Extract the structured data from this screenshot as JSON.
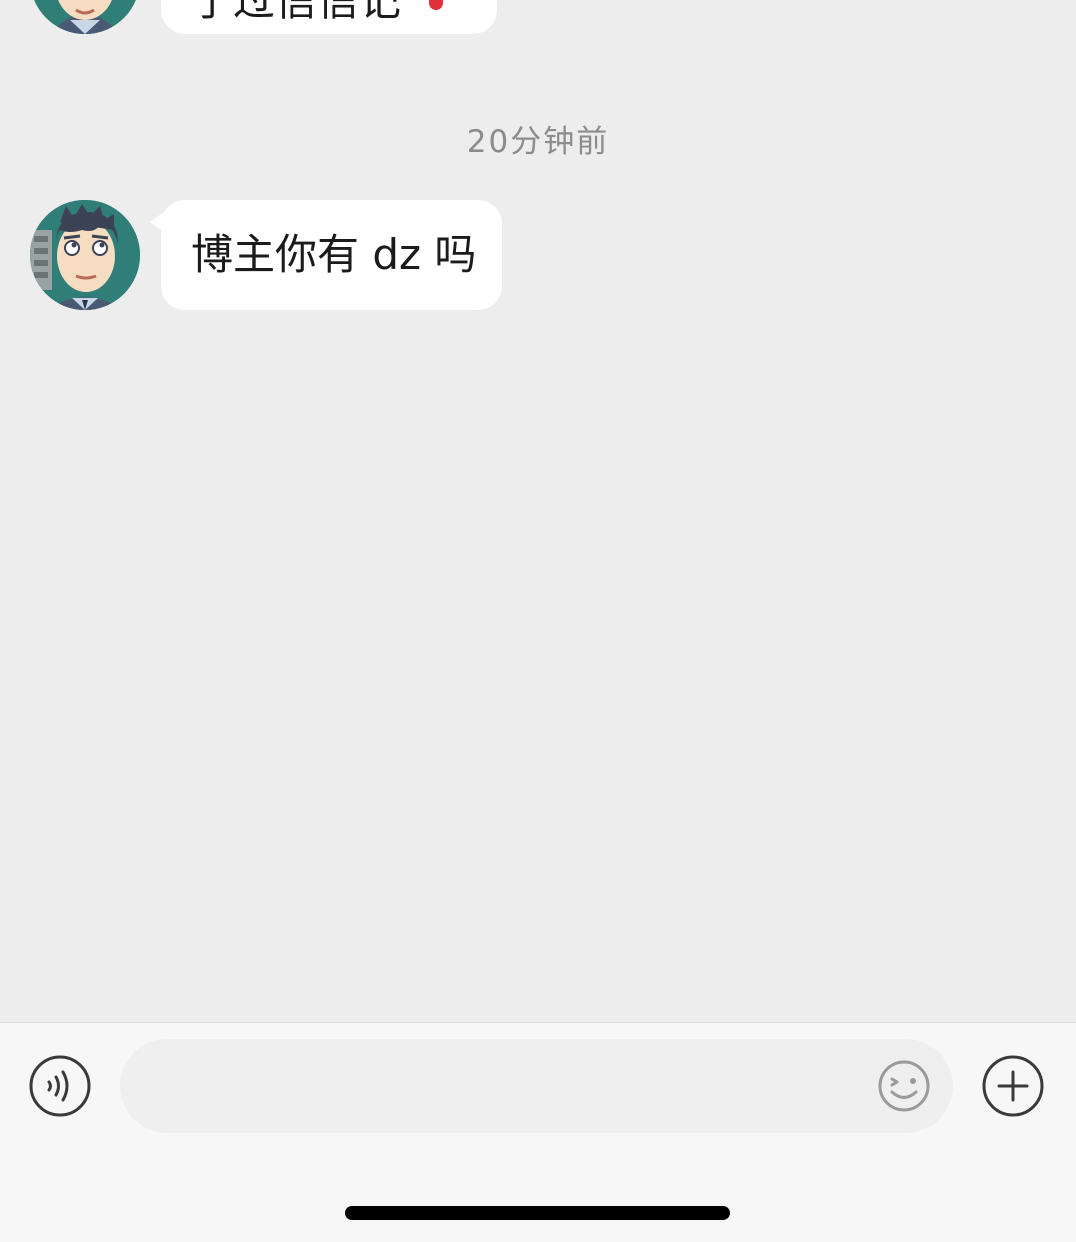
{
  "messages": [
    {
      "text": "了过信信记",
      "partial": true
    },
    {
      "timestamp": "20分钟前",
      "text": "博主你有 dz 吗"
    }
  ],
  "input": {
    "value": "",
    "placeholder": ""
  },
  "icons": {
    "voice": "voice-wave-icon",
    "emoji": "smiley-face-icon",
    "more": "plus-circle-icon"
  },
  "colors": {
    "background": "#ededed",
    "bubble": "#ffffff",
    "timestamp": "#8c8c8c",
    "input_bar": "#f7f7f7"
  }
}
